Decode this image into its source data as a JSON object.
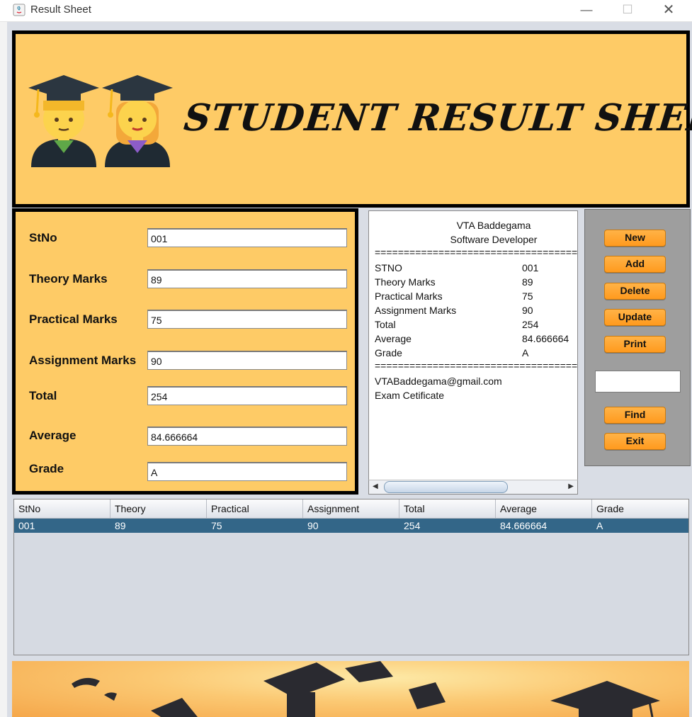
{
  "window": {
    "title": "Result Sheet",
    "minimize": "—",
    "maximize": "☐",
    "close": "✕"
  },
  "banner": {
    "title": "STUDENT RESULT SHEET"
  },
  "form": {
    "stno_label": "StNo",
    "stno_value": "001",
    "theory_label": "Theory Marks",
    "theory_value": "89",
    "practical_label": "Practical Marks",
    "practical_value": "75",
    "assignment_label": "Assignment Marks",
    "assignment_value": "90",
    "total_label": "Total",
    "total_value": "254",
    "average_label": "Average",
    "average_value": "84.666664",
    "grade_label": "Grade",
    "grade_value": "A"
  },
  "receipt": {
    "org": "VTA Baddegama",
    "role": "Software Developer",
    "separator": "====================================",
    "rows": [
      {
        "label": "STNO",
        "value": "001"
      },
      {
        "label": "Theory Marks",
        "value": "89"
      },
      {
        "label": "Practical Marks",
        "value": "75"
      },
      {
        "label": "Assignment Marks",
        "value": "90"
      },
      {
        "label": "Total",
        "value": "254"
      },
      {
        "label": "Average",
        "value": "84.666664"
      },
      {
        "label": "Grade",
        "value": "A"
      }
    ],
    "email": "VTABaddegama@gmail.com",
    "footer": "Exam Cetificate"
  },
  "buttons": {
    "new": "New",
    "add": "Add",
    "delete": "Delete",
    "update": "Update",
    "print": "Print",
    "find_value": "",
    "find": "Find",
    "exit": "Exit"
  },
  "table": {
    "columns": [
      "StNo",
      "Theory",
      "Practical",
      "Assignment",
      "Total",
      "Average",
      "Grade"
    ],
    "rows": [
      [
        "001",
        "89",
        "75",
        "90",
        "254",
        "84.666664",
        "A"
      ]
    ]
  },
  "colors": {
    "panel_orange": "#fecb66",
    "button_orange": "#ff9a1e",
    "selected_row": "#336688"
  }
}
